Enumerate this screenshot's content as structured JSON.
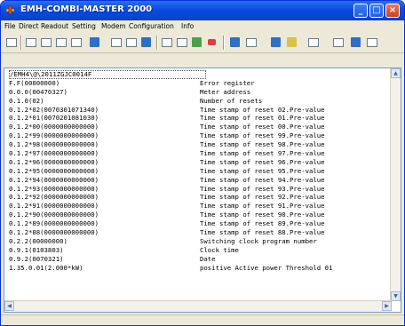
{
  "window": {
    "title": "EMH-COMBI-MASTER 2000",
    "app_icon": "tool-icon",
    "controls": {
      "minimize": "_",
      "maximize": "□",
      "close": "×"
    }
  },
  "menu": {
    "items": [
      "File",
      "Direct",
      "Readout",
      "Setting",
      "Modem",
      "Configuration",
      "Info"
    ]
  },
  "toolbar": {
    "icons": [
      "read-icon",
      "register-icon",
      "load-profile-icon",
      "log-icon",
      "table-icon",
      "meter-icon",
      "chart-icon",
      "graph-icon",
      "grid-icon",
      "device-icon",
      "download-icon",
      "save-icon",
      "print-icon",
      "copy-icon",
      "cut-icon",
      "delete-icon",
      "settings-icon",
      "window-icon"
    ]
  },
  "editor": {
    "lines": [
      {
        "addr": "/EMH4\\@\\2011ZGJC0014F",
        "desc": ""
      },
      {
        "addr": "F.F(00000000)",
        "desc": "Error register"
      },
      {
        "addr": "0.0.0(00470327)",
        "desc": "Meter address"
      },
      {
        "addr": "0.1.0(02)",
        "desc": "Number of resets"
      },
      {
        "addr": "0.1.2*02(0070301071340)",
        "desc": "Time stamp of reset 02.Pre-value"
      },
      {
        "addr": "0.1.2*01(0070201081030)",
        "desc": "Time stamp of reset 01.Pre-value"
      },
      {
        "addr": "0.1.2*00(0000000000000)",
        "desc": "Time stamp of reset 00.Pre-value"
      },
      {
        "addr": "0.1.2*99(0000000000000)",
        "desc": "Time stamp of reset 99.Pre-value"
      },
      {
        "addr": "0.1.2*98(0000000000000)",
        "desc": "Time stamp of reset 98.Pre-value"
      },
      {
        "addr": "0.1.2*97(0000000000000)",
        "desc": "Time stamp of reset 97.Pre-value"
      },
      {
        "addr": "0.1.2*96(0000000000000)",
        "desc": "Time stamp of reset 96.Pre-value"
      },
      {
        "addr": "0.1.2*95(0000000000000)",
        "desc": "Time stamp of reset 95.Pre-value"
      },
      {
        "addr": "0.1.2*94(0000000000000)",
        "desc": "Time stamp of reset 94.Pre-value"
      },
      {
        "addr": "0.1.2*93(0000000000000)",
        "desc": "Time stamp of reset 93.Pre-value"
      },
      {
        "addr": "0.1.2*92(0000000000000)",
        "desc": "Time stamp of reset 92.Pre-value"
      },
      {
        "addr": "0.1.2*91(0000000000000)",
        "desc": "Time stamp of reset 91.Pre-value"
      },
      {
        "addr": "0.1.2*90(0000000000000)",
        "desc": "Time stamp of reset 90.Pre-value"
      },
      {
        "addr": "0.1.2*89(0000000000000)",
        "desc": "Time stamp of reset 89.Pre-value"
      },
      {
        "addr": "0.1.2*88(0000000000000)",
        "desc": "Time stamp of reset 88.Pre-value"
      },
      {
        "addr": "0.2.2(00000000)",
        "desc": "Switching clock program number"
      },
      {
        "addr": "0.9.1(0103803)",
        "desc": "Clock time"
      },
      {
        "addr": "0.9.2(0070321)",
        "desc": "Date"
      },
      {
        "addr": "1.35.0.01(2.000*kW)",
        "desc": "positive Active power Threshold 01"
      }
    ]
  },
  "scrollbars": {
    "up": "▲",
    "down": "▼",
    "left": "◀",
    "right": "▶"
  }
}
